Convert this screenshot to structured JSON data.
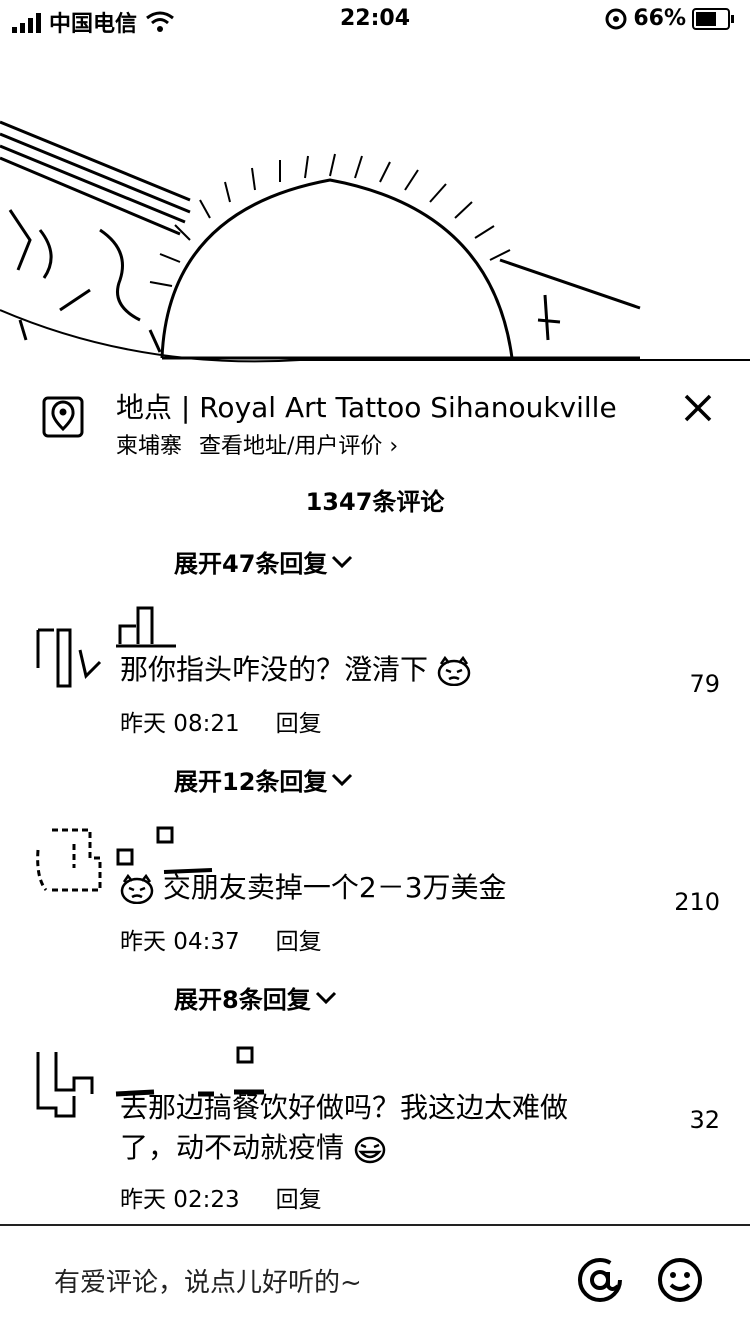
{
  "status_bar": {
    "carrier": "中国电信",
    "time": "22:04",
    "battery": "66%",
    "battery_level": 0.66
  },
  "location": {
    "title": "地点 | Royal Art Tattoo Sihanoukville",
    "country": "柬埔寨",
    "link": "查看地址/用户评价 ›",
    "icon": "location-pin-icon"
  },
  "comments_count": "1347条评论",
  "comments": [
    {
      "expand_label": "展开47条回复",
      "text": "那你指头咋没的？澄清下",
      "likes": "79",
      "time": "昨天 08:21",
      "reply_label": "回复"
    },
    {
      "expand_label": "展开12条回复",
      "text": "交朋友卖掉一个2－3万美金",
      "likes": "210",
      "time": "昨天 04:37",
      "reply_label": "回复"
    },
    {
      "expand_label": "展开8条回复",
      "text": "去那边搞餐饮好做吗？我这边太难做了，动不动就疫情",
      "likes": "32",
      "time": "昨天 02:23",
      "reply_label": "回复"
    }
  ],
  "input": {
    "placeholder": "有爱评论，说点儿好听的~"
  }
}
